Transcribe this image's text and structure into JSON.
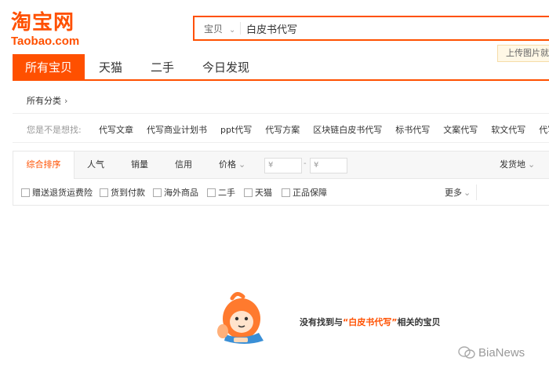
{
  "logo": {
    "cn": "淘宝网",
    "en": "Taobao.com"
  },
  "search": {
    "type_label": "宝贝",
    "query": "白皮书代写"
  },
  "upload_tip": "上传图片就",
  "tabs": [
    {
      "label": "所有宝贝",
      "active": true
    },
    {
      "label": "天猫"
    },
    {
      "label": "二手"
    },
    {
      "label": "今日发现"
    }
  ],
  "breadcrumb": {
    "label": "所有分类"
  },
  "suggestions": {
    "label": "您是不是想找:",
    "items": [
      "代写文章",
      "代写商业计划书",
      "ppt代写",
      "代写方案",
      "区块链白皮书代写",
      "标书代写",
      "文案代写",
      "软文代写",
      "代写"
    ]
  },
  "sort": {
    "active": "综合排序",
    "popularity": "人气",
    "sales": "销量",
    "credit": "信用",
    "price": "价格",
    "price_min_placeholder": "¥",
    "price_max_placeholder": "¥",
    "ship_from": "发货地"
  },
  "filters": [
    "赠送退货运费险",
    "货到付款",
    "海外商品",
    "二手",
    "天猫",
    "正品保障"
  ],
  "more": "更多",
  "empty": {
    "prefix": "没有找到与",
    "keyword": "“白皮书代写”",
    "suffix": "相关的宝贝"
  },
  "watermark": "BiaNews",
  "colors": {
    "brand": "#ff5000"
  }
}
